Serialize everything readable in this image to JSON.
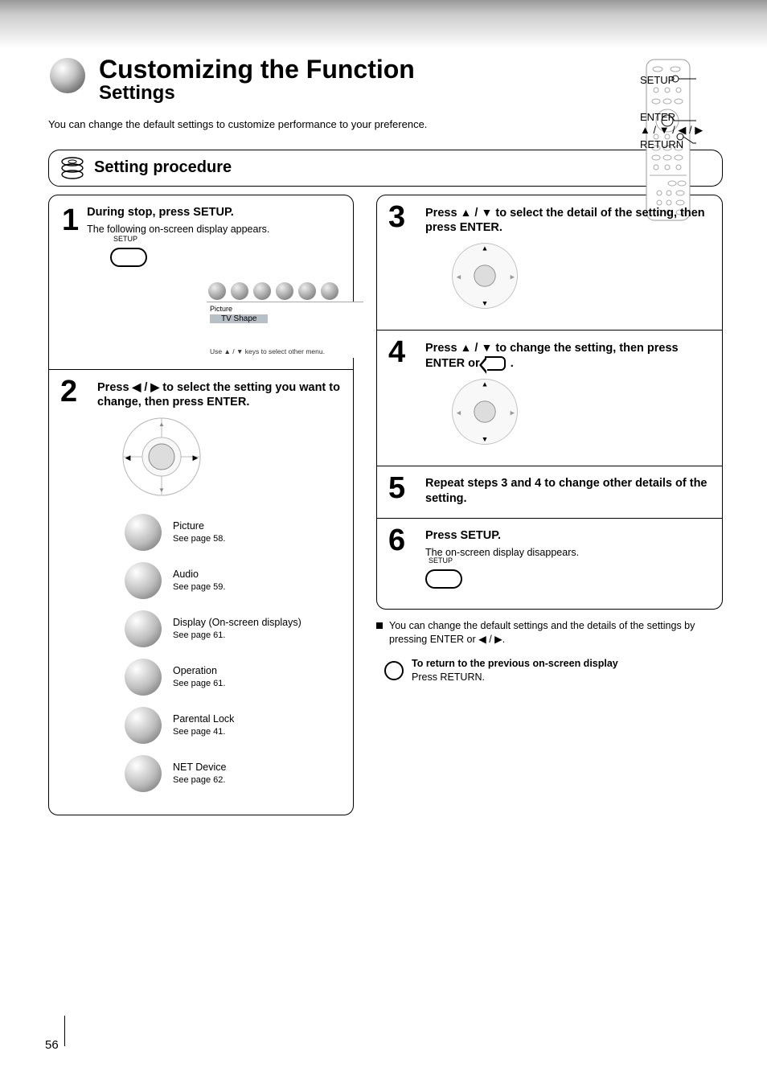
{
  "title": {
    "line1": "Customizing the Function",
    "line2": "Settings"
  },
  "intro": "You can change the default settings to customize performance to your preference.",
  "remote": {
    "callouts": {
      "setup": "SETUP",
      "enter_arrows": "ENTER\n▲ / ▼ / ◀ / ▶",
      "return": "RETURN"
    }
  },
  "proc_bar": "Setting procedure",
  "left": {
    "step1": {
      "num": "1",
      "head": "During stop, press SETUP.",
      "sub": "The following on-screen display appears.",
      "setup_label": "SETUP",
      "osd": {
        "top_label": "Picture",
        "option": "TV Shape",
        "hint": "Use ▲ / ▼  keys to select other menu."
      }
    },
    "step2": {
      "num": "2",
      "head_before": "Press ",
      "head_after": " / ",
      "head_end": " to select the setting you want to change, then press ENTER.",
      "icons": [
        {
          "name": "Picture",
          "page": "58"
        },
        {
          "name": "Audio",
          "page": "59"
        },
        {
          "name": "Display (On-screen displays)",
          "page": "61"
        },
        {
          "name": "Operation",
          "page": "61"
        },
        {
          "name": "Parental Lock",
          "page": "41"
        },
        {
          "name": "NET Device",
          "page": "62"
        }
      ]
    }
  },
  "right": {
    "step3": {
      "num": "3",
      "head_before": "Press ",
      "head_arrows": "▲ / ▼",
      "head_after": " to select the detail of the setting, then press ENTER."
    },
    "step4": {
      "num": "4",
      "head_a": "Press ",
      "head_arrows": "▲ / ▼",
      "head_b": " to change the setting, then press ENTER or ",
      "head_c": "."
    },
    "step5": {
      "num": "5",
      "head": "Repeat steps 3 and 4 to change other details of the setting."
    },
    "step6": {
      "num": "6",
      "head": "Press SETUP.",
      "sub": "The on-screen display disappears.",
      "setup_label": "SETUP"
    }
  },
  "return_text": "To return to the previous on-screen display\nPress RETURN.",
  "note_text": "You can change the default settings and the details of the settings by pressing ENTER or ◀ / ▶.",
  "page_number": "56"
}
